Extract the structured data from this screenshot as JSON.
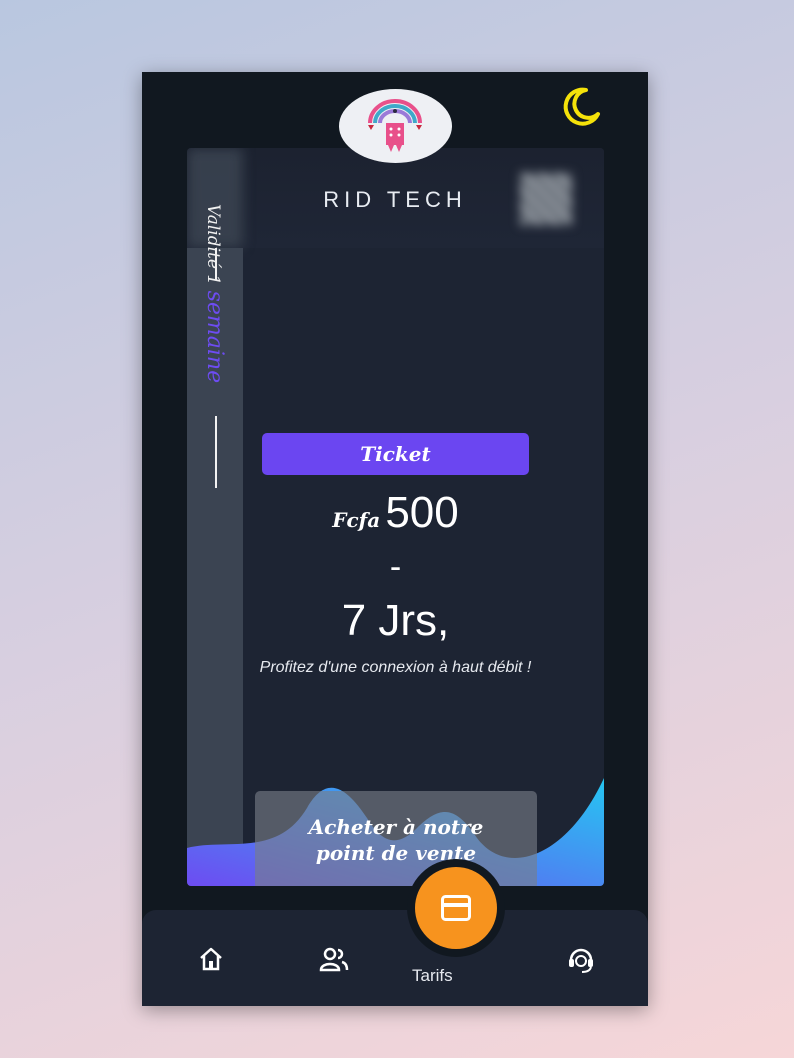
{
  "app": {
    "brand": "RID TECH"
  },
  "header": {
    "theme_toggle_icon": "moon-icon",
    "logo_icon": "rid-tech-logo-icon"
  },
  "ticket": {
    "label": "Ticket",
    "currency": "Fcfa",
    "amount": "500",
    "separator": "-",
    "duration": "7 Jrs,",
    "description": "Profitez d'une connexion à haut débit !",
    "validity_prefix": "Validité 1",
    "validity_unit": "semaine",
    "buy_label": "Acheter à notre point de vente"
  },
  "nav": {
    "items": [
      {
        "icon": "home-icon"
      },
      {
        "icon": "users-icon"
      },
      {
        "icon": "card-icon",
        "label": "Tarifs",
        "active": true
      },
      {
        "icon": "support-headset-icon"
      }
    ]
  },
  "colors": {
    "background": "#111820",
    "card": "#1d2433",
    "accent": "#6b46f1",
    "fab": "#f7931e",
    "moon": "#f5e20a",
    "wave_start": "#6d4cf2",
    "wave_end": "#25c6f2"
  }
}
